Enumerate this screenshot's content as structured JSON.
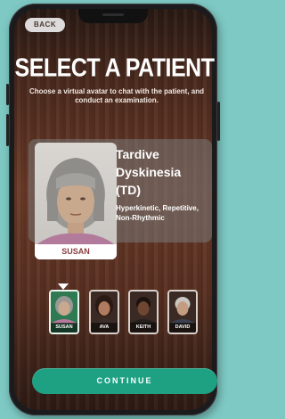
{
  "header": {
    "back_label": "BACK"
  },
  "title": "SELECT A PATIENT",
  "subtitle": "Choose a virtual avatar to chat with the patient, and conduct an examination.",
  "selected_patient": {
    "name": "SUSAN",
    "condition": "Tardive Dyskinesia (TD)",
    "description": "Hyperkinetic, Repetitive, Non-Rhythmic"
  },
  "patients": [
    {
      "name": "SUSAN",
      "selected": true
    },
    {
      "name": "AVA",
      "selected": false
    },
    {
      "name": "KEITH",
      "selected": false
    },
    {
      "name": "DAVID",
      "selected": false
    }
  ],
  "continue_label": "CONTINUE",
  "colors": {
    "accent": "#1ea083",
    "selected_thumb": "#2f7a52",
    "background": "#7ec9c4",
    "name_label": "#8a3c3c"
  }
}
